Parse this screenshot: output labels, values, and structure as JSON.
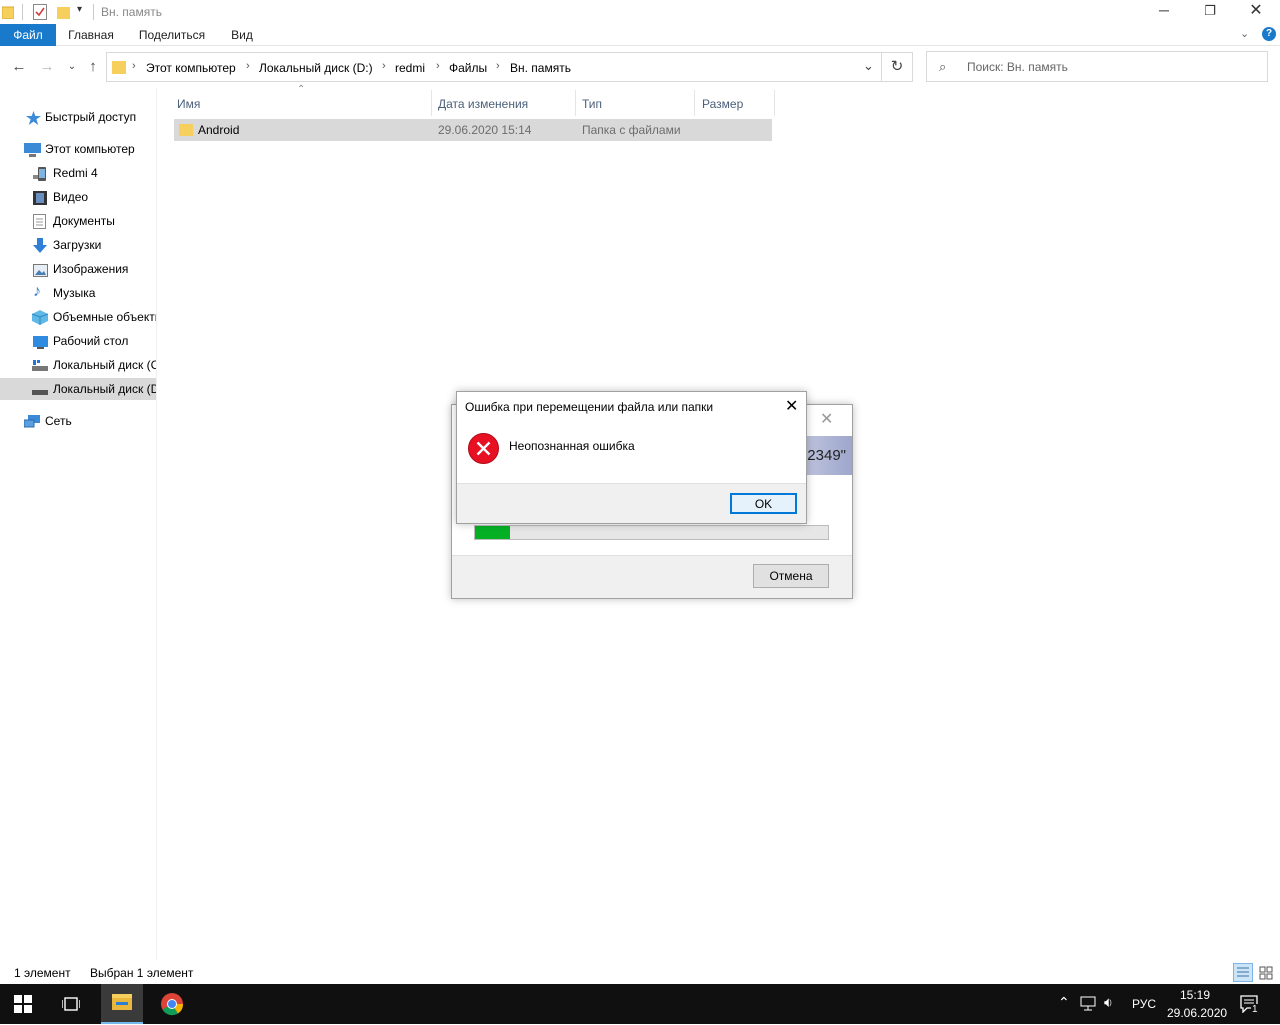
{
  "window": {
    "title": "Вн. память"
  },
  "ribbon": {
    "tabs": [
      "Файл",
      "Главная",
      "Поделиться",
      "Вид"
    ]
  },
  "address": {
    "crumbs": [
      "Этот компьютер",
      "Локальный диск (D:)",
      "redmi",
      "Файлы",
      "Вн. память"
    ],
    "search_placeholder": "Поиск: Вн. память"
  },
  "sidebar": {
    "items": [
      {
        "label": "Быстрый доступ",
        "icon": "star-icon"
      },
      {
        "label": "Этот компьютер",
        "icon": "computer-icon"
      },
      {
        "label": "Redmi 4",
        "icon": "phone-icon"
      },
      {
        "label": "Видео",
        "icon": "video-icon"
      },
      {
        "label": "Документы",
        "icon": "document-icon"
      },
      {
        "label": "Загрузки",
        "icon": "download-icon"
      },
      {
        "label": "Изображения",
        "icon": "image-icon"
      },
      {
        "label": "Музыка",
        "icon": "music-icon"
      },
      {
        "label": "Объемные объекты",
        "icon": "cube-icon"
      },
      {
        "label": "Рабочий стол",
        "icon": "desktop-icon"
      },
      {
        "label": "Локальный диск (C:)",
        "icon": "drive-icon"
      },
      {
        "label": "Локальный диск (D:)",
        "icon": "drive-icon"
      },
      {
        "label": "Сеть",
        "icon": "network-icon"
      }
    ]
  },
  "filelist": {
    "columns": [
      "Имя",
      "Дата изменения",
      "Тип",
      "Размер"
    ],
    "rows": [
      {
        "name": "Android",
        "date": "29.06.2020 15:14",
        "type": "Папка с файлами",
        "size": ""
      }
    ]
  },
  "status": {
    "count": "1 элемент",
    "selected": "Выбран 1 элемент"
  },
  "progress_dialog": {
    "banner_text": "2349\"",
    "progress": 0.1,
    "cancel_label": "Отмена",
    "accent": "#06b025"
  },
  "error_dialog": {
    "title": "Ошибка при перемещении файла или папки",
    "message": "Неопознанная ошибка",
    "ok_label": "OK",
    "icon": "error-icon"
  },
  "taskbar": {
    "lang": "РУС",
    "time": "15:19",
    "date": "29.06.2020",
    "notification_count": "1"
  },
  "colors": {
    "file_tab": "#1979ca",
    "selection": "#d9d9d9"
  }
}
